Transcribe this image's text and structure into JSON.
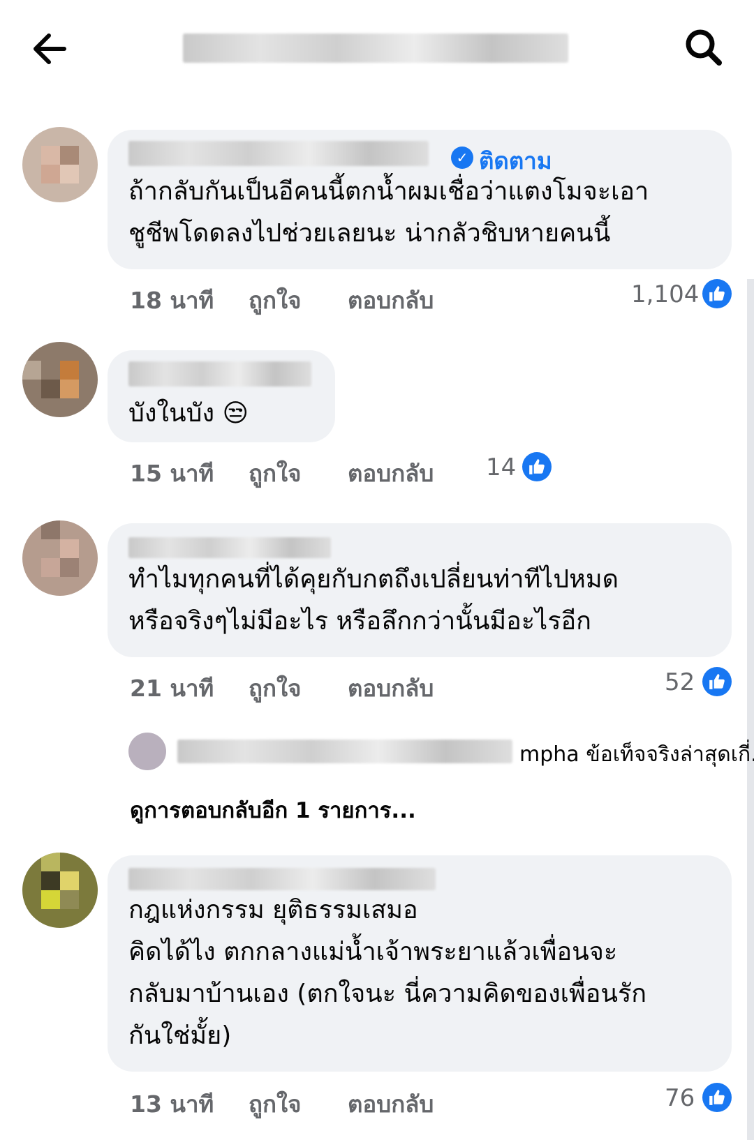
{
  "header": {
    "back_icon": "arrow-left-icon",
    "search_icon": "search-icon"
  },
  "comments": [
    {
      "text_lines": [
        "ถ้ากลับกันเป็นอีคนนี้ตกน้ำผมเชื่อว่าแตงโมจะเอา",
        "ชูชีพโดดลงไปช่วยเลยนะ น่ากลัวชิบหายคนนี้"
      ],
      "follow_label": "ติดตาม",
      "time": "18 นาที",
      "like_label": "ถูกใจ",
      "reply_label": "ตอบกลับ",
      "reactions": "1,104"
    },
    {
      "text_lines": [
        "บังในบัง 😒"
      ],
      "time": "15 นาที",
      "like_label": "ถูกใจ",
      "reply_label": "ตอบกลับ",
      "reactions": "14"
    },
    {
      "text_lines": [
        "ทำไมทุกคนที่ได้คุยกับกตถึงเปลี่ยนท่าทีไปหมด",
        "หรือจริงๆไม่มีอะไร หรือลึกกว่านั้นมีอะไรอีก"
      ],
      "time": "21 นาที",
      "like_label": "ถูกใจ",
      "reply_label": "ตอบกลับ",
      "reactions": "52",
      "reply_preview": "mpha ข้อเท็จจริงล่าสุดเกี่...",
      "view_more": "ดูการตอบกลับอีก 1 รายการ..."
    },
    {
      "text_lines": [
        "กฎแห่งกรรม ยุติธรรมเสมอ",
        "คิดได้ไง ตกกลางแม่น้ำเจ้าพระยาแล้วเพื่อนจะ",
        "กลับมาบ้านเอง (ตกใจนะ นี่ความคิดของเพื่อนรัก",
        "กันใช่มั้ย)"
      ],
      "time": "13 นาที",
      "like_label": "ถูกใจ",
      "reply_label": "ตอบกลับ",
      "reactions": "76"
    }
  ],
  "colors": {
    "accent": "#1877f2",
    "bubble": "#f0f2f5",
    "meta": "#65676b"
  }
}
